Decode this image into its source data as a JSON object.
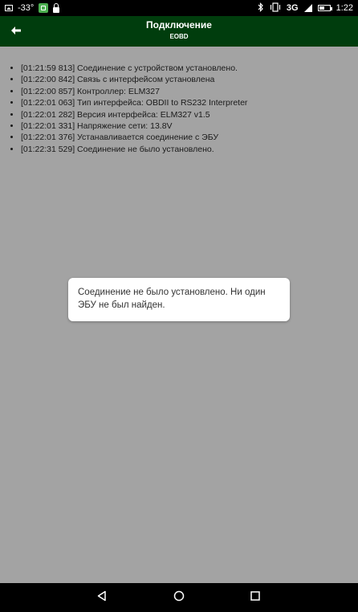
{
  "status_bar": {
    "temperature": "-33°",
    "network": "3G",
    "time": "1:22",
    "icons": [
      "gallery-icon",
      "app-icon",
      "lock-icon",
      "bluetooth-icon",
      "vibrate-icon",
      "signal-icon",
      "battery-icon"
    ]
  },
  "toolbar": {
    "title": "Подключение",
    "subtitle": "EOBD",
    "back_icon": "arrow-left-icon"
  },
  "log": [
    "[01:21:59 813] Соединение с устройством установлено.",
    "[01:22:00 842] Связь с интерфейсом установлена",
    "[01:22:00 857] Контроллер: ELM327",
    "[01:22:01 063] Тип интерфейса: OBDII to RS232 Interpreter",
    "[01:22:01 282] Версия интерфейса: ELM327 v1.5",
    "[01:22:01 331] Напряжение сети: 13.8V",
    "[01:22:01 376] Устанавливается соединение с ЭБУ",
    "[01:22:31 529] Соединение не было установлено."
  ],
  "toast": {
    "message": "Соединение не было установлено. Ни один ЭБУ не был найден."
  },
  "nav_bar": {
    "icons": [
      "back-triangle-icon",
      "home-circle-icon",
      "recents-square-icon"
    ]
  },
  "colors": {
    "toolbar_bg": "#003d0d",
    "content_bg": "#a3a3a3",
    "toast_bg": "#ffffff"
  }
}
